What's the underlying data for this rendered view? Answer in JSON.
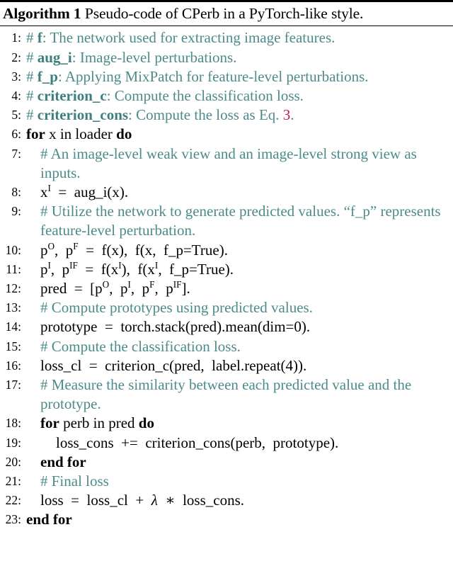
{
  "algorithm": {
    "label": "Algorithm 1",
    "title": "Pseudo-code of CPerb in a PyTorch-like style.",
    "colors": {
      "comment": "#4d8b8b",
      "comment_bold": "#3d7f7f",
      "code": "#000000",
      "equation_reference": "#c8105a",
      "rule": "#000000",
      "background": "#ffffff"
    },
    "lines": [
      {
        "number": "1:",
        "indent": 0,
        "kind": "comment",
        "parts": [
          {
            "text": "# ",
            "style": "comment"
          },
          {
            "text": "f",
            "style": "comment-bold"
          },
          {
            "text": ": The network used for extracting image features.",
            "style": "comment"
          }
        ]
      },
      {
        "number": "2:",
        "indent": 0,
        "kind": "comment",
        "parts": [
          {
            "text": "# ",
            "style": "comment"
          },
          {
            "text": "aug_i",
            "style": "comment-bold"
          },
          {
            "text": ": Image-level perturbations.",
            "style": "comment"
          }
        ]
      },
      {
        "number": "3:",
        "indent": 0,
        "kind": "comment",
        "parts": [
          {
            "text": "# ",
            "style": "comment"
          },
          {
            "text": "f_p",
            "style": "comment-bold"
          },
          {
            "text": ": Applying MixPatch for feature-level perturbations.",
            "style": "comment"
          }
        ]
      },
      {
        "number": "4:",
        "indent": 0,
        "kind": "comment",
        "parts": [
          {
            "text": "# ",
            "style": "comment"
          },
          {
            "text": "criterion_c",
            "style": "comment-bold"
          },
          {
            "text": ": Compute the classification loss.",
            "style": "comment"
          }
        ]
      },
      {
        "number": "5:",
        "indent": 0,
        "kind": "comment",
        "parts": [
          {
            "text": "# ",
            "style": "comment"
          },
          {
            "text": "criterion_cons",
            "style": "comment-bold"
          },
          {
            "text": ": Compute the loss as Eq. ",
            "style": "comment"
          },
          {
            "text": "3",
            "style": "eqref"
          },
          {
            "text": ".",
            "style": "comment"
          }
        ]
      },
      {
        "number": "6:",
        "indent": 0,
        "kind": "code",
        "parts": [
          {
            "text": "for",
            "style": "keyword"
          },
          {
            "text": " x in loader ",
            "style": "code"
          },
          {
            "text": "do",
            "style": "keyword"
          }
        ]
      },
      {
        "number": "7:",
        "indent": 1,
        "kind": "comment",
        "parts": [
          {
            "text": "# An image-level weak view and an image-level strong view as inputs.",
            "style": "comment"
          }
        ]
      },
      {
        "number": "8:",
        "indent": 1,
        "kind": "code",
        "parts": [
          {
            "text": "x",
            "style": "code"
          },
          {
            "text": "I",
            "style": "sup"
          },
          {
            "text": "  =  aug_i(x).",
            "style": "code"
          }
        ]
      },
      {
        "number": "9:",
        "indent": 1,
        "kind": "comment",
        "parts": [
          {
            "text": "# Utilize the network to generate predicted values. “f_p” represents feature-level perturbation.",
            "style": "comment"
          }
        ]
      },
      {
        "number": "10:",
        "indent": 1,
        "kind": "code",
        "parts": [
          {
            "text": "p",
            "style": "code"
          },
          {
            "text": "O",
            "style": "sup"
          },
          {
            "text": ",  p",
            "style": "code"
          },
          {
            "text": "F",
            "style": "sup"
          },
          {
            "text": "  =  f(x),  f(x,  f_p=True).",
            "style": "code"
          }
        ]
      },
      {
        "number": "11:",
        "indent": 1,
        "kind": "code",
        "parts": [
          {
            "text": "p",
            "style": "code"
          },
          {
            "text": "I",
            "style": "sup"
          },
          {
            "text": ",  p",
            "style": "code"
          },
          {
            "text": "IF",
            "style": "sup"
          },
          {
            "text": "  =  f(x",
            "style": "code"
          },
          {
            "text": "I",
            "style": "sup"
          },
          {
            "text": "),  f(x",
            "style": "code"
          },
          {
            "text": "I",
            "style": "sup"
          },
          {
            "text": ",  f_p=True).",
            "style": "code"
          }
        ]
      },
      {
        "number": "12:",
        "indent": 1,
        "kind": "code",
        "parts": [
          {
            "text": "pred  =  [p",
            "style": "code"
          },
          {
            "text": "O",
            "style": "sup"
          },
          {
            "text": ",  p",
            "style": "code"
          },
          {
            "text": "I",
            "style": "sup"
          },
          {
            "text": ",  p",
            "style": "code"
          },
          {
            "text": "F",
            "style": "sup"
          },
          {
            "text": ",  p",
            "style": "code"
          },
          {
            "text": "IF",
            "style": "sup"
          },
          {
            "text": "].",
            "style": "code"
          }
        ]
      },
      {
        "number": "13:",
        "indent": 1,
        "kind": "comment",
        "parts": [
          {
            "text": "# Compute prototypes using predicted values.",
            "style": "comment"
          }
        ]
      },
      {
        "number": "14:",
        "indent": 1,
        "kind": "code",
        "parts": [
          {
            "text": "prototype  =  torch.stack(pred).mean(dim=0).",
            "style": "code"
          }
        ]
      },
      {
        "number": "15:",
        "indent": 1,
        "kind": "comment",
        "parts": [
          {
            "text": "# Compute the classification loss.",
            "style": "comment"
          }
        ]
      },
      {
        "number": "16:",
        "indent": 1,
        "kind": "code",
        "parts": [
          {
            "text": "loss_cl  =  criterion_c(pred,  label.repeat(4)).",
            "style": "code"
          }
        ]
      },
      {
        "number": "17:",
        "indent": 1,
        "kind": "comment",
        "parts": [
          {
            "text": "# Measure the similarity between each predicted value and the prototype.",
            "style": "comment"
          }
        ]
      },
      {
        "number": "18:",
        "indent": 1,
        "kind": "code",
        "parts": [
          {
            "text": "for",
            "style": "keyword"
          },
          {
            "text": " perb in pred ",
            "style": "code"
          },
          {
            "text": "do",
            "style": "keyword"
          }
        ]
      },
      {
        "number": "19:",
        "indent": 2,
        "kind": "code",
        "parts": [
          {
            "text": "loss_cons  +=  criterion_cons(perb,  prototype).",
            "style": "code"
          }
        ]
      },
      {
        "number": "20:",
        "indent": 1,
        "kind": "code",
        "parts": [
          {
            "text": "end for",
            "style": "keyword"
          }
        ]
      },
      {
        "number": "21:",
        "indent": 1,
        "kind": "comment",
        "parts": [
          {
            "text": "# Final loss",
            "style": "comment"
          }
        ]
      },
      {
        "number": "22:",
        "indent": 1,
        "kind": "code",
        "parts": [
          {
            "text": "loss  =  loss_cl  +  ",
            "style": "code"
          },
          {
            "text": "λ",
            "style": "lambda"
          },
          {
            "text": "  ∗  loss_cons.",
            "style": "code"
          }
        ]
      },
      {
        "number": "23:",
        "indent": 0,
        "kind": "code",
        "parts": [
          {
            "text": "end for",
            "style": "keyword"
          }
        ]
      }
    ]
  }
}
